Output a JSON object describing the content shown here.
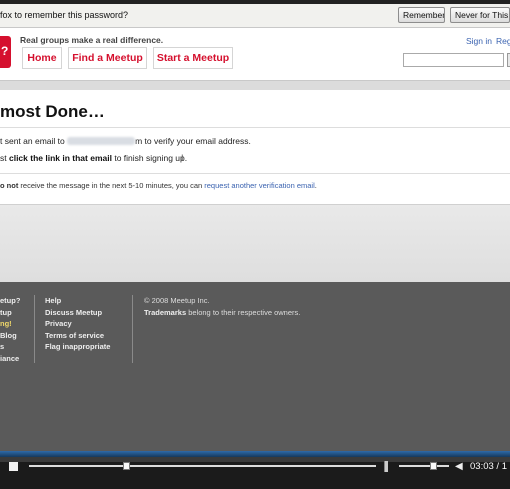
{
  "password_bar": {
    "message": "fox to remember this password?",
    "remember_label": "Remember",
    "never_label": "Never for This Sit"
  },
  "header": {
    "logo_glyph": "?",
    "tagline": "Real groups make a real difference.",
    "nav": [
      "Home",
      "Find a Meetup",
      "Start a Meetup"
    ],
    "signin": "Sign in",
    "register": "Reg"
  },
  "content": {
    "title": "most Done…",
    "line1_pre": "t sent an email to",
    "line1_post": "m to verify your email address.",
    "line2_pre": "st ",
    "line2_bold": "click the link in that email",
    "line2_post": " to finish signing up.",
    "line3_bold": "o not",
    "line3_mid": " receive the message in the next 5-10 minutes, you can ",
    "line3_link": "request another verification email",
    "line3_end": "."
  },
  "footer": {
    "col1": [
      "etup?",
      "tup",
      "ng!",
      "Blog",
      "s",
      "iance"
    ],
    "col2": [
      "Help",
      "Discuss Meetup",
      "Privacy",
      "Terms of service",
      "Flag inappropriate"
    ],
    "copyright": "© 2008 Meetup Inc.",
    "trademarks_bold": "Trademarks",
    "trademarks_rest": " belong to their respective owners."
  },
  "video": {
    "time": "03:03 / 1",
    "progress_fraction": 0.28,
    "volume_fraction": 0.68
  }
}
